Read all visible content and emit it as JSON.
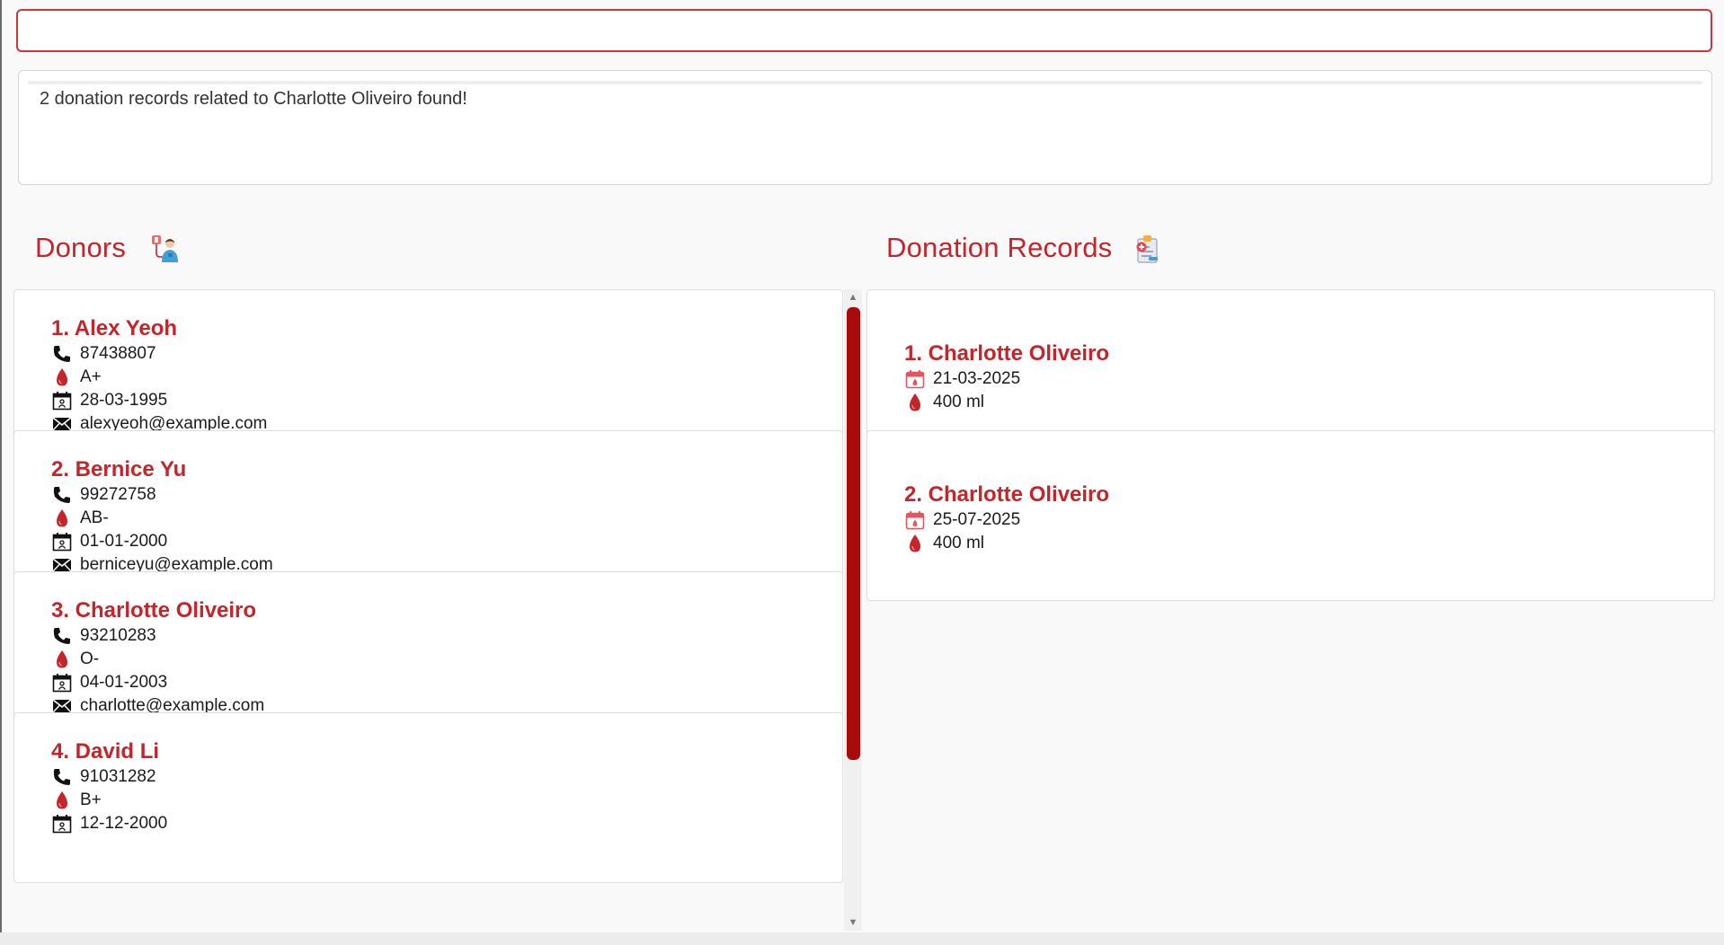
{
  "command": {
    "value": "",
    "placeholder": ""
  },
  "result": {
    "message": "2 donation records related to Charlotte Oliveiro found!"
  },
  "donors_panel": {
    "title": "Donors",
    "icon": "donor-patient-icon",
    "donors": [
      {
        "name": "1. Alex Yeoh",
        "phone": "87438807",
        "blood_type": "A+",
        "dob": "28-03-1995",
        "email": "alexyeoh@example.com"
      },
      {
        "name": "2. Bernice Yu",
        "phone": "99272758",
        "blood_type": "AB-",
        "dob": "01-01-2000",
        "email": "berniceyu@example.com"
      },
      {
        "name": "3. Charlotte Oliveiro",
        "phone": "93210283",
        "blood_type": "O-",
        "dob": "04-01-2003",
        "email": "charlotte@example.com"
      },
      {
        "name": "4. David Li",
        "phone": "91031282",
        "blood_type": "B+",
        "dob": "12-12-2000",
        "email": ""
      }
    ]
  },
  "records_panel": {
    "title": "Donation Records",
    "icon": "medical-record-icon",
    "records": [
      {
        "name": "1. Charlotte Oliveiro",
        "date": "21-03-2025",
        "volume": "400 ml"
      },
      {
        "name": "2. Charlotte Oliveiro",
        "date": "25-07-2025",
        "volume": "400 ml"
      }
    ]
  },
  "colors": {
    "accent": "#c3252b",
    "scroll_thumb": "#a80b0b",
    "command_border": "#d0333b"
  }
}
